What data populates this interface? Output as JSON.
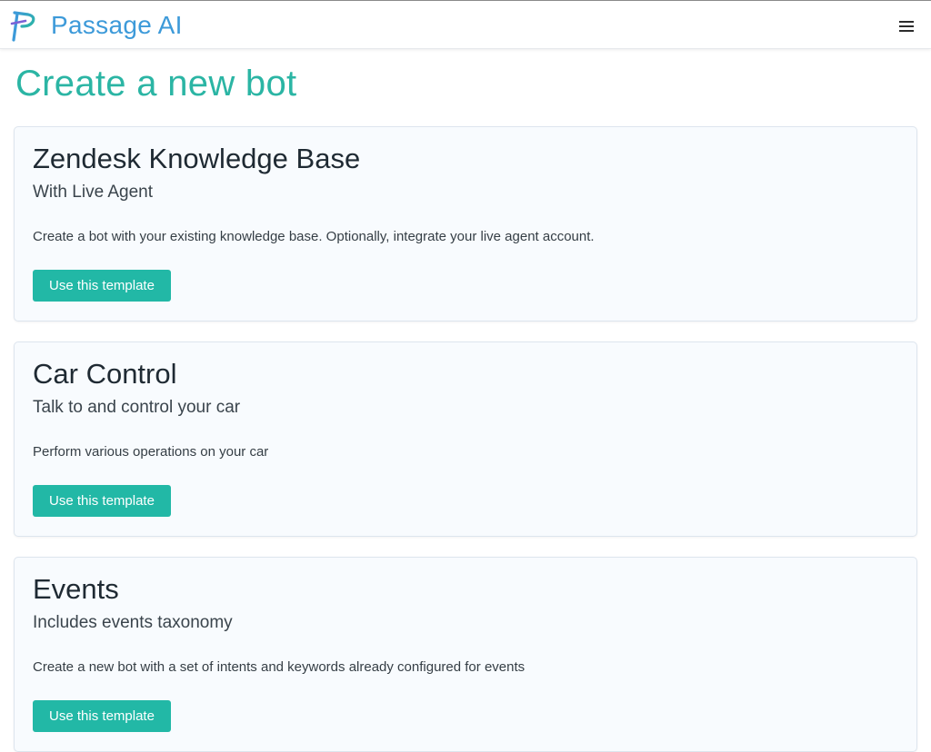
{
  "header": {
    "brand": "Passage AI",
    "logo_icon": "passage-p-logo",
    "menu_icon": "hamburger-menu-icon"
  },
  "page": {
    "title": "Create a new bot"
  },
  "templates": [
    {
      "title": "Zendesk Knowledge Base",
      "subtitle": "With Live Agent",
      "description": "Create a bot with your existing knowledge base. Optionally, integrate your live agent account.",
      "button": "Use this template"
    },
    {
      "title": "Car Control",
      "subtitle": "Talk to and control your car",
      "description": "Perform various operations on your car",
      "button": "Use this template"
    },
    {
      "title": "Events",
      "subtitle": "Includes events taxonomy",
      "description": "Create a new bot with a set of intents and keywords already configured for events",
      "button": "Use this template"
    }
  ],
  "colors": {
    "brand": "#3d9ad9",
    "accent": "#2bb5a4",
    "button": "#22b8a6",
    "card_bg": "#f8fbfe"
  }
}
